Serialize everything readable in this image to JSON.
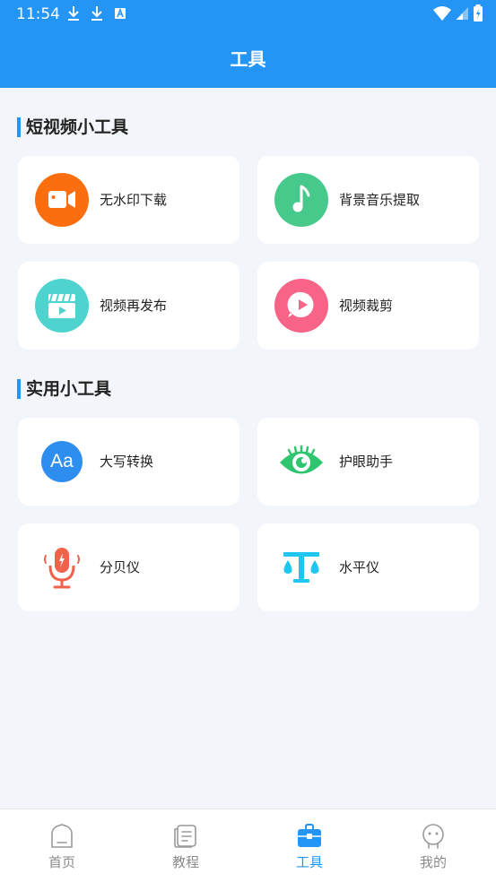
{
  "status_bar": {
    "time": "11:54"
  },
  "header": {
    "title": "工具"
  },
  "sections": [
    {
      "title": "短视频小工具"
    },
    {
      "title": "实用小工具"
    }
  ],
  "tools": {
    "no_watermark": "无水印下载",
    "bg_music": "背景音乐提取",
    "repost": "视频再发布",
    "video_crop": "视频裁剪",
    "uppercase": "大写转换",
    "eye_care": "护眼助手",
    "decibel": "分贝仪",
    "level": "水平仪"
  },
  "uppercase_icon_text": "Aa",
  "tabbar": {
    "home": "首页",
    "tutorial": "教程",
    "tools": "工具",
    "mine": "我的",
    "active": "tools"
  },
  "colors": {
    "primary": "#2595f5",
    "orange": "#fa6e0f",
    "green": "#46c98a",
    "teal": "#4fd3cf",
    "pink": "#f86488",
    "red_mic": "#f0634a",
    "cyan_level": "#1ec6f0"
  }
}
